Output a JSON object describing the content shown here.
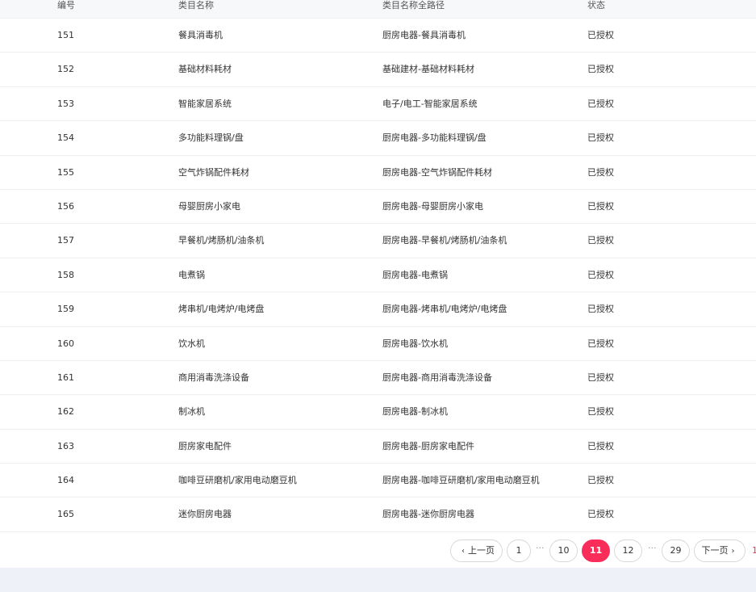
{
  "table": {
    "headers": [
      "编号",
      "类目名称",
      "类目名称全路径",
      "状态"
    ],
    "rows": [
      {
        "id": "151",
        "name": "餐具消毒机",
        "path": "厨房电器-餐具消毒机",
        "status": "已授权"
      },
      {
        "id": "152",
        "name": "基础材料耗材",
        "path": "基础建材-基础材料耗材",
        "status": "已授权"
      },
      {
        "id": "153",
        "name": "智能家居系统",
        "path": "电子/电工-智能家居系统",
        "status": "已授权"
      },
      {
        "id": "154",
        "name": "多功能料理锅/盘",
        "path": "厨房电器-多功能料理锅/盘",
        "status": "已授权"
      },
      {
        "id": "155",
        "name": "空气炸锅配件耗材",
        "path": "厨房电器-空气炸锅配件耗材",
        "status": "已授权"
      },
      {
        "id": "156",
        "name": "母婴厨房小家电",
        "path": "厨房电器-母婴厨房小家电",
        "status": "已授权"
      },
      {
        "id": "157",
        "name": "早餐机/烤肠机/油条机",
        "path": "厨房电器-早餐机/烤肠机/油条机",
        "status": "已授权"
      },
      {
        "id": "158",
        "name": "电煮锅",
        "path": "厨房电器-电煮锅",
        "status": "已授权"
      },
      {
        "id": "159",
        "name": "烤串机/电烤炉/电烤盘",
        "path": "厨房电器-烤串机/电烤炉/电烤盘",
        "status": "已授权"
      },
      {
        "id": "160",
        "name": "饮水机",
        "path": "厨房电器-饮水机",
        "status": "已授权"
      },
      {
        "id": "161",
        "name": "商用消毒洗涤设备",
        "path": "厨房电器-商用消毒洗涤设备",
        "status": "已授权"
      },
      {
        "id": "162",
        "name": "制冰机",
        "path": "厨房电器-制冰机",
        "status": "已授权"
      },
      {
        "id": "163",
        "name": "厨房家电配件",
        "path": "厨房电器-厨房家电配件",
        "status": "已授权"
      },
      {
        "id": "164",
        "name": "咖啡豆研磨机/家用电动磨豆机",
        "path": "厨房电器-咖啡豆研磨机/家用电动磨豆机",
        "status": "已授权"
      },
      {
        "id": "165",
        "name": "迷你厨房电器",
        "path": "厨房电器-迷你厨房电器",
        "status": "已授权"
      }
    ]
  },
  "pagination": {
    "prev_label": "上一页",
    "next_label": "下一页",
    "first_page": "1",
    "dots": "···",
    "page_10": "10",
    "current_page": "11",
    "page_12": "12",
    "last_page": "29",
    "trailing_text": "1",
    "accent_color": "#fa2d5a"
  }
}
